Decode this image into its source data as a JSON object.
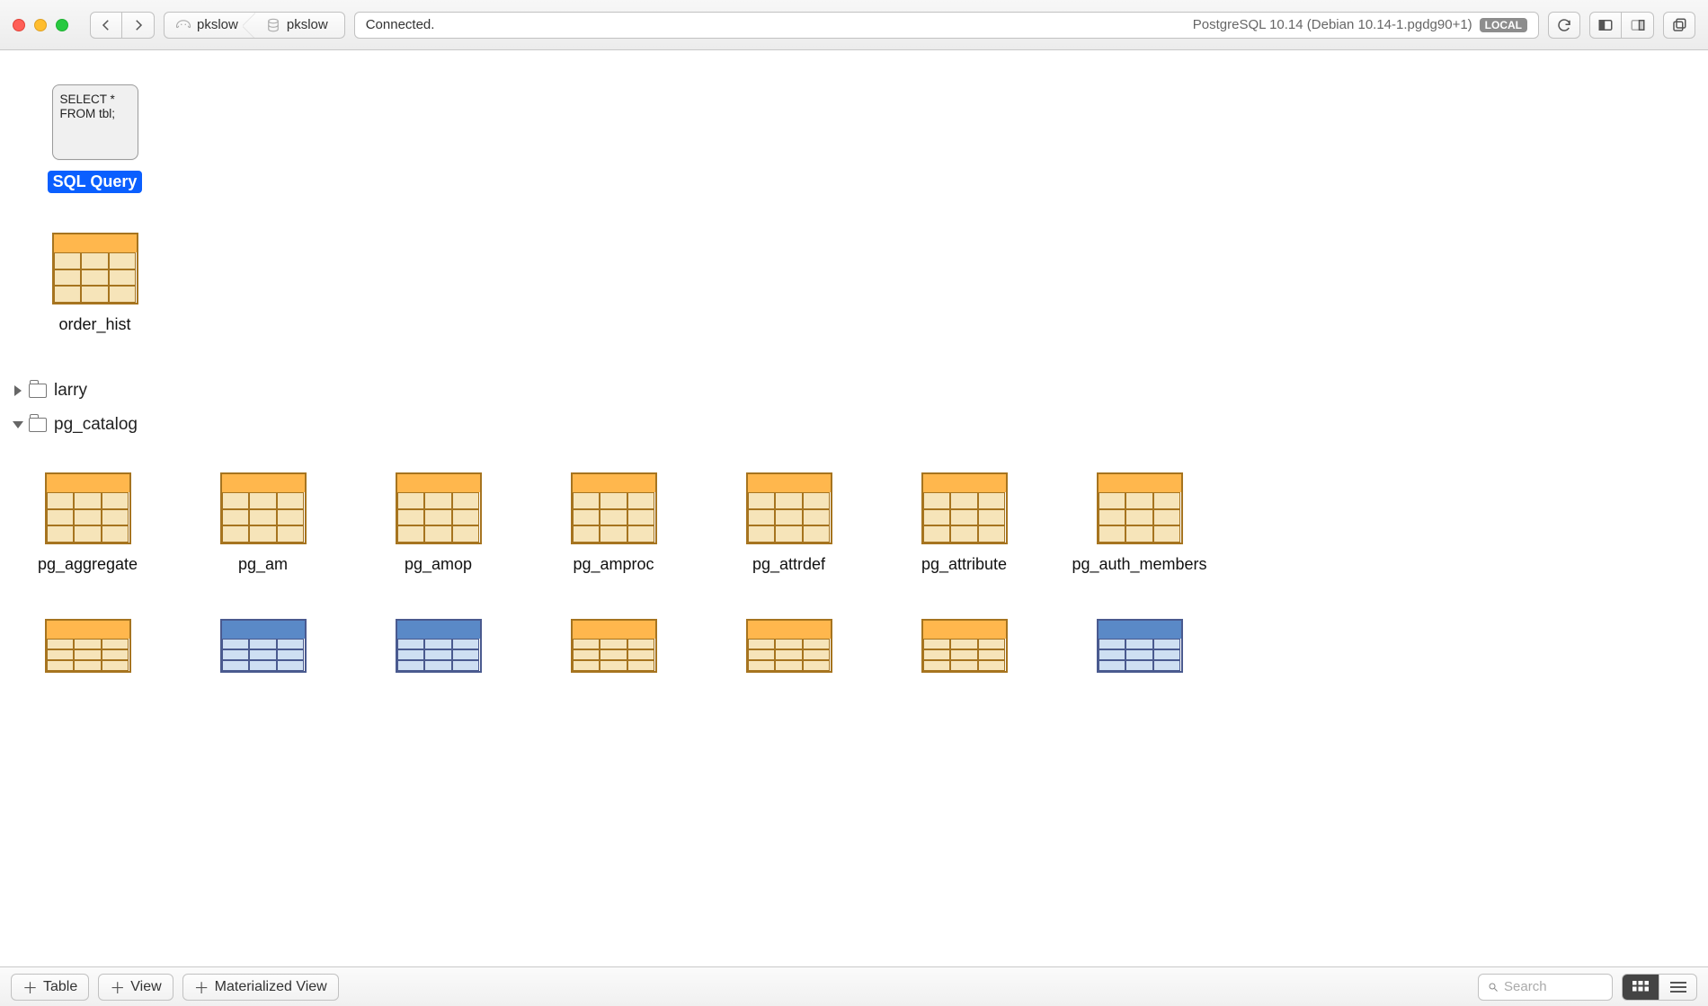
{
  "toolbar": {
    "breadcrumb": [
      {
        "icon": "elephant-icon",
        "label": "pkslow"
      },
      {
        "icon": "database-icon",
        "label": "pkslow"
      }
    ],
    "status_left": "Connected.",
    "status_right": "PostgreSQL 10.14 (Debian 10.14-1.pgdg90+1)",
    "badge": "LOCAL"
  },
  "sql_item": {
    "line1": "SELECT *",
    "line2": "FROM tbl;",
    "label": "SQL Query"
  },
  "root_tables": [
    {
      "label": "order_hist",
      "kind": "table"
    }
  ],
  "folders": [
    {
      "label": "larry",
      "open": false
    },
    {
      "label": "pg_catalog",
      "open": true
    }
  ],
  "catalog_row1": [
    {
      "label": "pg_aggregate",
      "kind": "table"
    },
    {
      "label": "pg_am",
      "kind": "table"
    },
    {
      "label": "pg_amop",
      "kind": "table"
    },
    {
      "label": "pg_amproc",
      "kind": "table"
    },
    {
      "label": "pg_attrdef",
      "kind": "table"
    },
    {
      "label": "pg_attribute",
      "kind": "table"
    },
    {
      "label": "pg_auth_members",
      "kind": "table"
    }
  ],
  "catalog_row2": [
    {
      "kind": "table"
    },
    {
      "kind": "view"
    },
    {
      "kind": "view"
    },
    {
      "kind": "table"
    },
    {
      "kind": "table"
    },
    {
      "kind": "table"
    },
    {
      "kind": "view"
    }
  ],
  "bottom": {
    "add_table": "Table",
    "add_view": "View",
    "add_matview": "Materialized View",
    "search_placeholder": "Search"
  }
}
